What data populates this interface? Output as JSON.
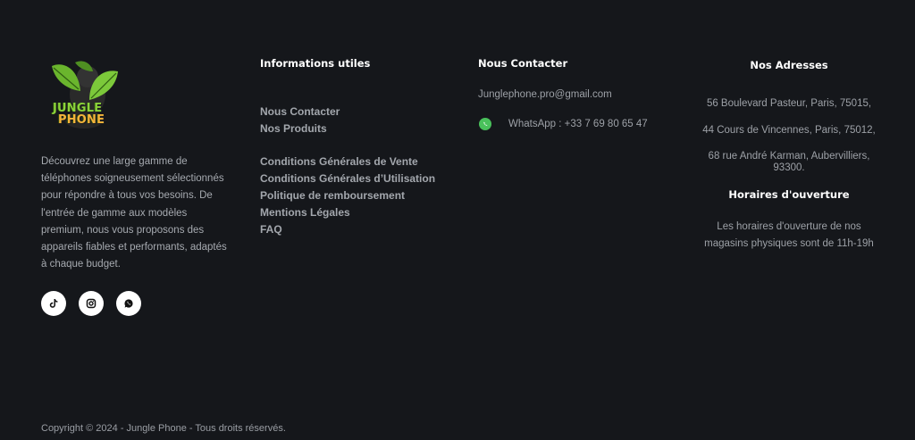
{
  "brand": {
    "logo_line1": "JUNGLE",
    "logo_line2": "PHONE",
    "description": "Découvrez une large gamme de téléphones soigneusement sélectionnés pour répondre à tous vos besoins. De l'entrée de gamme aux modèles premium, nous vous proposons des appareils fiables et performants, adaptés à chaque budget.",
    "socials": [
      {
        "name": "tiktok-icon"
      },
      {
        "name": "instagram-icon"
      },
      {
        "name": "whatsapp-icon"
      }
    ]
  },
  "info": {
    "title": "Informations utiles",
    "links_a": [
      "Nous Contacter",
      "Nos Produits"
    ],
    "links_b": [
      "Conditions Générales de Vente",
      "Conditions Générales d’Utilisation",
      "Politique de remboursement",
      "Mentions Légales",
      "FAQ"
    ]
  },
  "contact": {
    "title": "Nous Contacter",
    "email": "Junglephone.pro@gmail.com",
    "whatsapp": "WhatsApp : +33 7 69 80 65 47"
  },
  "addresses": {
    "title": "Nos Adresses",
    "items": [
      "56 Boulevard Pasteur, Paris, 75015,",
      "44 Cours de Vincennes, Paris, 75012,",
      "68 rue André Karman, Aubervilliers, 93300."
    ],
    "hours_title": "Horaires d'ouverture",
    "hours_text": "Les horaires d'ouverture de nos magasins physiques sont de 11h-19h"
  },
  "footer": {
    "copyright": "Copyright © 2024 - Jungle Phone - Tous droits réservés."
  },
  "colors": {
    "background": "#15171b",
    "heading": "#ffffff",
    "text": "#9ca0a6",
    "whatsapp": "#49c15b"
  }
}
